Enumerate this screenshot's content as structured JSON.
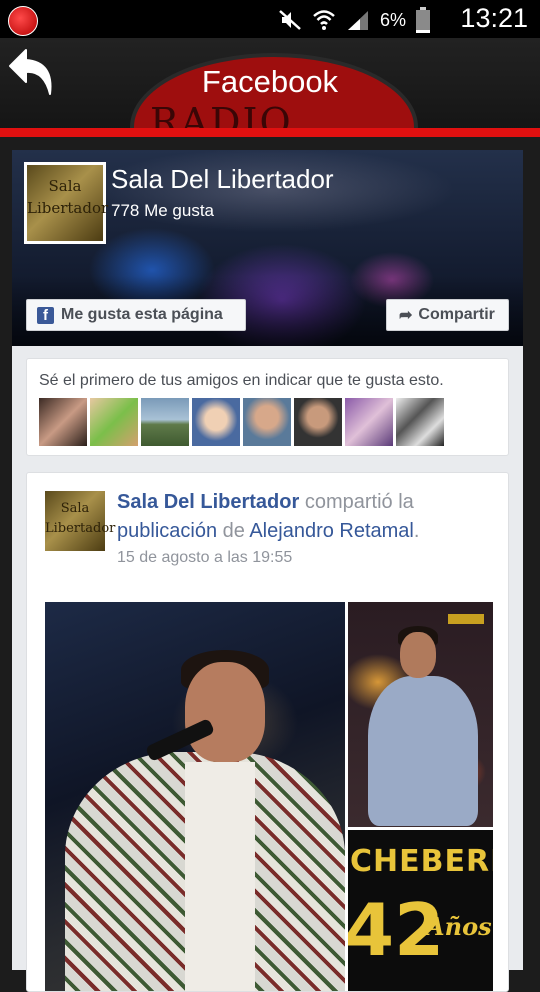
{
  "status_bar": {
    "battery": "6%",
    "time": "13:21"
  },
  "app_bar": {
    "title": "Facebook",
    "logo_text": "RADIO"
  },
  "page": {
    "name": "Sala Del Libertador",
    "likes": "778 Me gusta",
    "avatar_text_line1": "Sala",
    "avatar_text_line2": "Libertador",
    "like_button": "Me gusta esta página",
    "share_button": "Compartir"
  },
  "friends": {
    "text": "Sé el primero de tus amigos en indicar que te gusta esto.",
    "count": 8
  },
  "post": {
    "author": "Sala Del Libertador",
    "verb": "compartió la",
    "object": "publicación",
    "preposition": "de",
    "source": "Alejandro Retamal",
    "period": ".",
    "timestamp": "15 de agosto a las 19:55",
    "poster_title": "CHEBERE",
    "poster_number": "42",
    "poster_years": "Años"
  },
  "colors": {
    "accent_red": "#e01010",
    "fb_blue": "#3b5998",
    "link_blue": "#365899"
  }
}
